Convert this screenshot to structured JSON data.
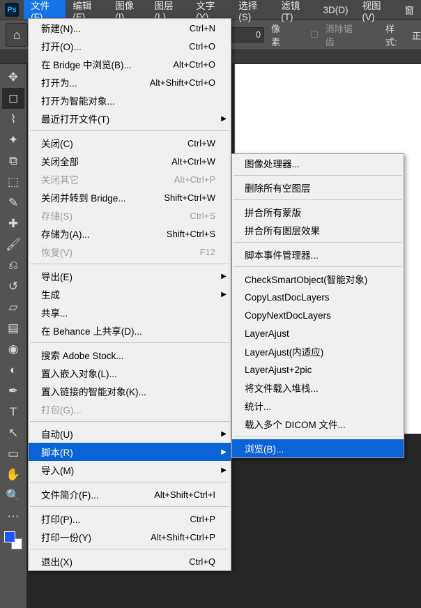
{
  "appbar": {
    "menus": [
      {
        "label": "文件(F)",
        "active": true
      },
      {
        "label": "编辑(E)"
      },
      {
        "label": "图像(I)"
      },
      {
        "label": "图层(L)"
      },
      {
        "label": "文字(Y)"
      },
      {
        "label": "选择(S)"
      },
      {
        "label": "滤镜(T)"
      },
      {
        "label": "3D(D)"
      },
      {
        "label": "视图(V)"
      },
      {
        "label": "窗"
      }
    ]
  },
  "optbar": {
    "value": "0",
    "unit": "像素",
    "antialias": "消除锯齿",
    "style": "样式:",
    "style_val": "正"
  },
  "file_menu": [
    {
      "t": "item",
      "label": "新建(N)...",
      "kbd": "Ctrl+N"
    },
    {
      "t": "item",
      "label": "打开(O)...",
      "kbd": "Ctrl+O"
    },
    {
      "t": "item",
      "label": "在 Bridge 中浏览(B)...",
      "kbd": "Alt+Ctrl+O"
    },
    {
      "t": "item",
      "label": "打开为...",
      "kbd": "Alt+Shift+Ctrl+O"
    },
    {
      "t": "item",
      "label": "打开为智能对象..."
    },
    {
      "t": "item",
      "label": "最近打开文件(T)",
      "sub": true
    },
    {
      "t": "sep"
    },
    {
      "t": "item",
      "label": "关闭(C)",
      "kbd": "Ctrl+W"
    },
    {
      "t": "item",
      "label": "关闭全部",
      "kbd": "Alt+Ctrl+W"
    },
    {
      "t": "item",
      "label": "关闭其它",
      "kbd": "Alt+Ctrl+P",
      "disabled": true
    },
    {
      "t": "item",
      "label": "关闭并转到 Bridge...",
      "kbd": "Shift+Ctrl+W"
    },
    {
      "t": "item",
      "label": "存储(S)",
      "kbd": "Ctrl+S",
      "disabled": true
    },
    {
      "t": "item",
      "label": "存储为(A)...",
      "kbd": "Shift+Ctrl+S"
    },
    {
      "t": "item",
      "label": "恢复(V)",
      "kbd": "F12",
      "disabled": true
    },
    {
      "t": "sep"
    },
    {
      "t": "item",
      "label": "导出(E)",
      "sub": true
    },
    {
      "t": "item",
      "label": "生成",
      "sub": true
    },
    {
      "t": "item",
      "label": "共享..."
    },
    {
      "t": "item",
      "label": "在 Behance 上共享(D)..."
    },
    {
      "t": "sep"
    },
    {
      "t": "item",
      "label": "搜索 Adobe Stock..."
    },
    {
      "t": "item",
      "label": "置入嵌入对象(L)..."
    },
    {
      "t": "item",
      "label": "置入链接的智能对象(K)..."
    },
    {
      "t": "item",
      "label": "打包(G)...",
      "disabled": true
    },
    {
      "t": "sep"
    },
    {
      "t": "item",
      "label": "自动(U)",
      "sub": true
    },
    {
      "t": "item",
      "label": "脚本(R)",
      "sub": true,
      "highlight": true
    },
    {
      "t": "item",
      "label": "导入(M)",
      "sub": true
    },
    {
      "t": "sep"
    },
    {
      "t": "item",
      "label": "文件简介(F)...",
      "kbd": "Alt+Shift+Ctrl+I"
    },
    {
      "t": "sep"
    },
    {
      "t": "item",
      "label": "打印(P)...",
      "kbd": "Ctrl+P"
    },
    {
      "t": "item",
      "label": "打印一份(Y)",
      "kbd": "Alt+Shift+Ctrl+P"
    },
    {
      "t": "sep"
    },
    {
      "t": "item",
      "label": "退出(X)",
      "kbd": "Ctrl+Q"
    }
  ],
  "sub_menu": [
    {
      "t": "item",
      "label": "图像处理器..."
    },
    {
      "t": "sep"
    },
    {
      "t": "item",
      "label": "删除所有空图层"
    },
    {
      "t": "sep"
    },
    {
      "t": "item",
      "label": "拼合所有蒙版"
    },
    {
      "t": "item",
      "label": "拼合所有图层效果"
    },
    {
      "t": "sep"
    },
    {
      "t": "item",
      "label": "脚本事件管理器..."
    },
    {
      "t": "sep"
    },
    {
      "t": "item",
      "label": "CheckSmartObject(智能对象)"
    },
    {
      "t": "item",
      "label": "CopyLastDocLayers"
    },
    {
      "t": "item",
      "label": "CopyNextDocLayers"
    },
    {
      "t": "item",
      "label": "LayerAjust"
    },
    {
      "t": "item",
      "label": "LayerAjust(内适应)"
    },
    {
      "t": "item",
      "label": "LayerAjust+2pic"
    },
    {
      "t": "item",
      "label": "将文件载入堆栈..."
    },
    {
      "t": "item",
      "label": "统计..."
    },
    {
      "t": "item",
      "label": "载入多个 DICOM 文件..."
    },
    {
      "t": "sep"
    },
    {
      "t": "item",
      "label": "浏览(B)...",
      "highlight": true
    }
  ],
  "tools": [
    "move",
    "marquee",
    "lasso",
    "wand",
    "crop",
    "frame",
    "eyedrop",
    "heal",
    "brush",
    "stamp",
    "history",
    "eraser",
    "gradient",
    "blur",
    "dodge",
    "pen",
    "type",
    "path",
    "rect",
    "hand",
    "zoom",
    "more"
  ]
}
